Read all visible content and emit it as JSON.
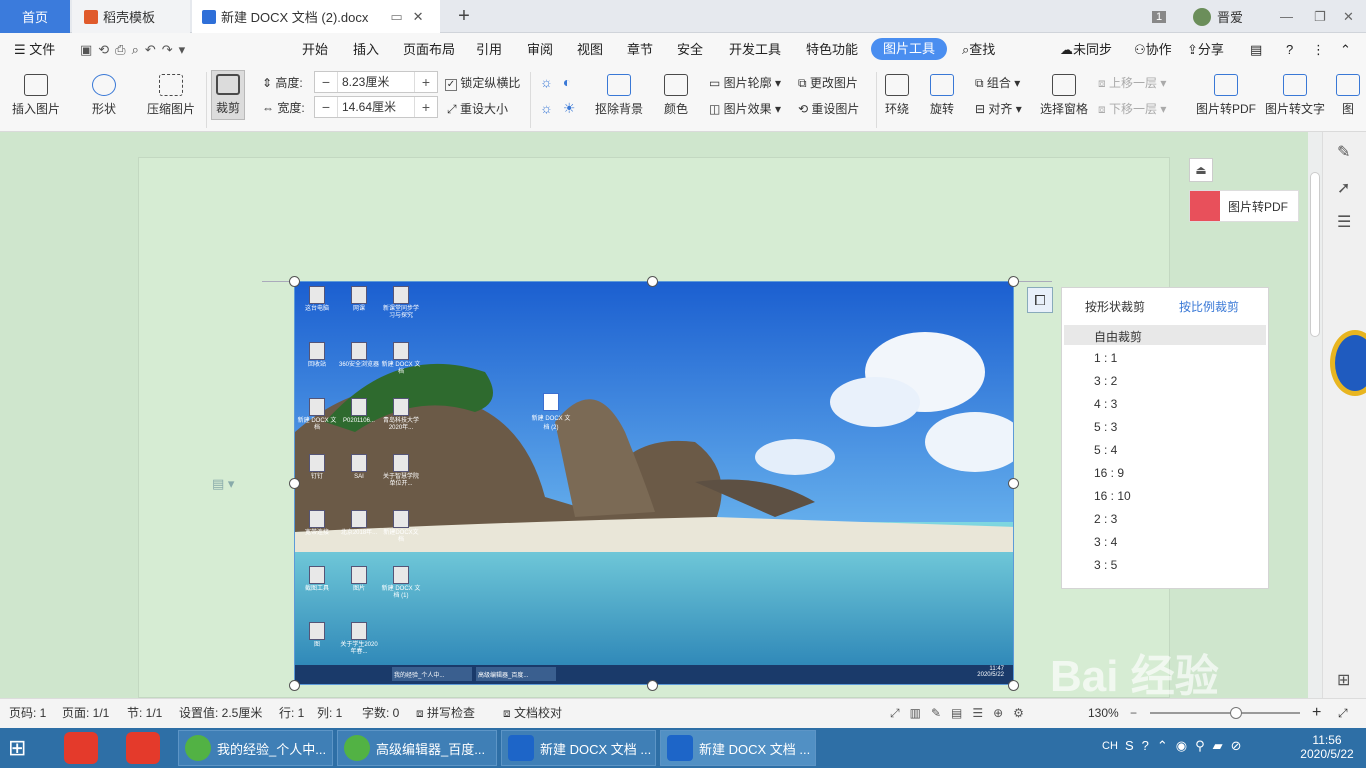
{
  "titlebar": {
    "home_tab": "首页",
    "template_tab": "稻壳模板",
    "doc_tab": "新建 DOCX 文档 (2).docx",
    "new_tab": "+",
    "badge_count": "1",
    "user_name": "晋爱"
  },
  "menu": {
    "file": "文件",
    "items": [
      "开始",
      "插入",
      "页面布局",
      "引用",
      "审阅",
      "视图",
      "章节",
      "安全",
      "开发工具",
      "特色功能",
      "图片工具"
    ],
    "search": "查找",
    "sync": "未同步",
    "collab": "协作",
    "share": "分享",
    "help": "?"
  },
  "ribbon": {
    "insert_image": "插入图片",
    "shape": "形状",
    "compress": "压缩图片",
    "crop": "裁剪",
    "height_label": "高度:",
    "height_value": "8.23厘米",
    "width_label": "宽度:",
    "width_value": "14.64厘米",
    "lock_ratio": "锁定纵横比",
    "reset_size": "重设大小",
    "remove_bg": "抠除背景",
    "color": "颜色",
    "outline": "图片轮廓",
    "effect": "图片效果",
    "change_img": "更改图片",
    "reset_img": "重设图片",
    "wrap": "环绕",
    "rotate": "旋转",
    "group": "组合",
    "align": "对齐",
    "select_pane": "选择窗格",
    "bring_forward": "上移一层",
    "send_backward": "下移一层",
    "to_pdf": "图片转PDF",
    "to_text": "图片转文字",
    "more": "图"
  },
  "side": {
    "pdf_button": "图片转PDF"
  },
  "crop_popup": {
    "tab_shape": "按形状裁剪",
    "tab_ratio": "按比例裁剪",
    "free": "自由裁剪",
    "ratios": [
      "1 : 1",
      "3 : 2",
      "4 : 3",
      "5 : 3",
      "5 : 4",
      "16 : 9",
      "16 : 10",
      "2 : 3",
      "3 : 4",
      "3 : 5"
    ]
  },
  "desktop_icons": [
    "这台电脑",
    "网课",
    "新课堂同步学习与探究",
    "回收站",
    "360安全浏览器",
    "新建 DOCX 文档",
    "新建 DOCX 文档",
    "P0201106...",
    "青岛科技大学2020年...",
    "钉钉",
    "SAI",
    "关于智慧学院单位开...",
    "宽带连接",
    "北京2018年...",
    "新建DOCX文档",
    "截图工具",
    "图片",
    "新建 DOCX 文档 (1)",
    "图",
    "关于学生2020年春..."
  ],
  "desktop_doc_icon": "新建 DOCX 文档 (2)",
  "desktop_taskbar": [
    "我的经验_个人中...",
    "高级编辑器_百度..."
  ],
  "desktop_clock": [
    "11:47",
    "2020/5/22"
  ],
  "status": {
    "page_code": "页码: 1",
    "pages": "页面: 1/1",
    "section": "节: 1/1",
    "setting": "设置值: 2.5厘米",
    "row": "行: 1",
    "col": "列: 1",
    "words": "字数: 0",
    "spell": "拼写检查",
    "proof": "文档校对",
    "zoom": "130%"
  },
  "taskbar": {
    "items": [
      "我的经验_个人中...",
      "高级编辑器_百度...",
      "新建 DOCX 文档 ...",
      "新建 DOCX 文档 ..."
    ],
    "lang": "CH",
    "time": "11:56",
    "date": "2020/5/22"
  },
  "watermark": "Bai 经验 jingyan.baidu.com"
}
